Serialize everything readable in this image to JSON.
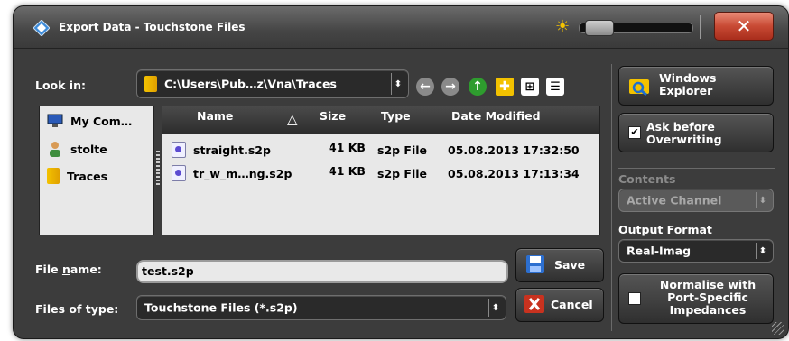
{
  "window": {
    "title": "Export Data - Touchstone Files",
    "close_glyph": "✕",
    "sun_glyph": "☀"
  },
  "look_in": {
    "label": "Look in:",
    "path": "C:\\Users\\Pub…z\\Vna\\Traces",
    "arrow": "⬍"
  },
  "nav_icons": [
    "back-arrow-icon",
    "forward-arrow-icon",
    "up-folder-icon",
    "new-folder-icon",
    "list-view-icon",
    "detail-view-icon"
  ],
  "places": [
    {
      "label": "My Com…"
    },
    {
      "label": "stolte"
    },
    {
      "label": "Traces"
    }
  ],
  "table": {
    "headers": {
      "name": "Name",
      "sort": "△",
      "size": "Size",
      "type": "Type",
      "date": "Date Modified"
    },
    "rows": [
      {
        "name": "straight.s2p",
        "size": "41 KB",
        "type": "s2p File",
        "date": "05.08.2013 17:32:50"
      },
      {
        "name": "tr_w_m…ng.s2p",
        "size": "41 KB",
        "type": "s2p File",
        "date": "05.08.2013 17:13:34"
      }
    ]
  },
  "file_name": {
    "label": "File name:",
    "label_pre": "File ",
    "label_ul": "n",
    "label_post": "ame:",
    "value": "test.s2p"
  },
  "files_of_type": {
    "label": "Files of type:",
    "value": "Touchstone Files (*.s2p)",
    "arrow": "⬍"
  },
  "buttons": {
    "save": "Save",
    "cancel": "Cancel",
    "windows_explorer_1": "Windows",
    "windows_explorer_2": "Explorer"
  },
  "ask_before": {
    "line1": "Ask before",
    "line2": "Overwriting",
    "checked": true,
    "mark": "✔"
  },
  "contents": {
    "label": "Contents",
    "value": "Active Channel",
    "arrow": "⬍"
  },
  "output_format": {
    "label": "Output Format",
    "value": "Real-Imag",
    "arrow": "⬍"
  },
  "normalise": {
    "line1": "Normalise with",
    "line2": "Port-Specific",
    "line3": "Impedances",
    "checked": false
  },
  "colors": {
    "accent_red": "#c84a34",
    "folder_yellow": "#f3c200",
    "panel": "#e8e8e8",
    "dialog_bg": "#3c3c3c"
  }
}
